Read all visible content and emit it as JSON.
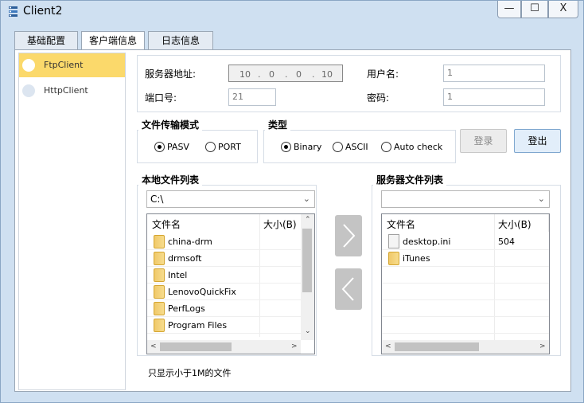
{
  "window": {
    "title": "Client2",
    "minimize_label": "—",
    "maximize_label": "☐",
    "close_label": "X"
  },
  "tabs": [
    {
      "label": "基础配置"
    },
    {
      "label": "客户端信息"
    },
    {
      "label": "日志信息"
    }
  ],
  "sidebar": {
    "items": [
      {
        "label": "FtpClient",
        "selected": true
      },
      {
        "label": "HttpClient",
        "selected": false
      }
    ]
  },
  "server": {
    "address_label": "服务器地址:",
    "ip": [
      "10",
      "0",
      "0",
      "10"
    ],
    "port_label": "端口号:",
    "port_value": "21",
    "user_label": "用户名:",
    "user_value": "1",
    "password_label": "密码:",
    "password_value": "1"
  },
  "transfer_mode": {
    "title": "文件传输模式",
    "options": [
      {
        "label": "PASV",
        "selected": true
      },
      {
        "label": "PORT",
        "selected": false
      }
    ]
  },
  "type_group": {
    "title": "类型",
    "options": [
      {
        "label": "Binary",
        "selected": true
      },
      {
        "label": "ASCII",
        "selected": false
      },
      {
        "label": "Auto check",
        "selected": false
      }
    ]
  },
  "buttons": {
    "login": "登录",
    "logout": "登出"
  },
  "local": {
    "title": "本地文件列表",
    "path": "C:\\",
    "col_name": "文件名",
    "col_size": "大小(B)",
    "files": [
      {
        "name": "china-drm",
        "type": "folder"
      },
      {
        "name": "drmsoft",
        "type": "folder"
      },
      {
        "name": "Intel",
        "type": "folder"
      },
      {
        "name": "LenovoQuickFix",
        "type": "folder"
      },
      {
        "name": "PerfLogs",
        "type": "folder"
      },
      {
        "name": "Program Files",
        "type": "folder"
      }
    ]
  },
  "remote": {
    "title": "服务器文件列表",
    "path": "",
    "col_name": "文件名",
    "col_size": "大小(B)",
    "files": [
      {
        "name": "desktop.ini",
        "size": "504",
        "type": "file"
      },
      {
        "name": "iTunes",
        "size": "",
        "type": "folder"
      }
    ]
  },
  "note": "只显示小于1M的文件",
  "colors": {
    "selected_item": "#fbd96b",
    "window_bg": "#cfe0f1",
    "logout_border": "#7fa7cf"
  }
}
